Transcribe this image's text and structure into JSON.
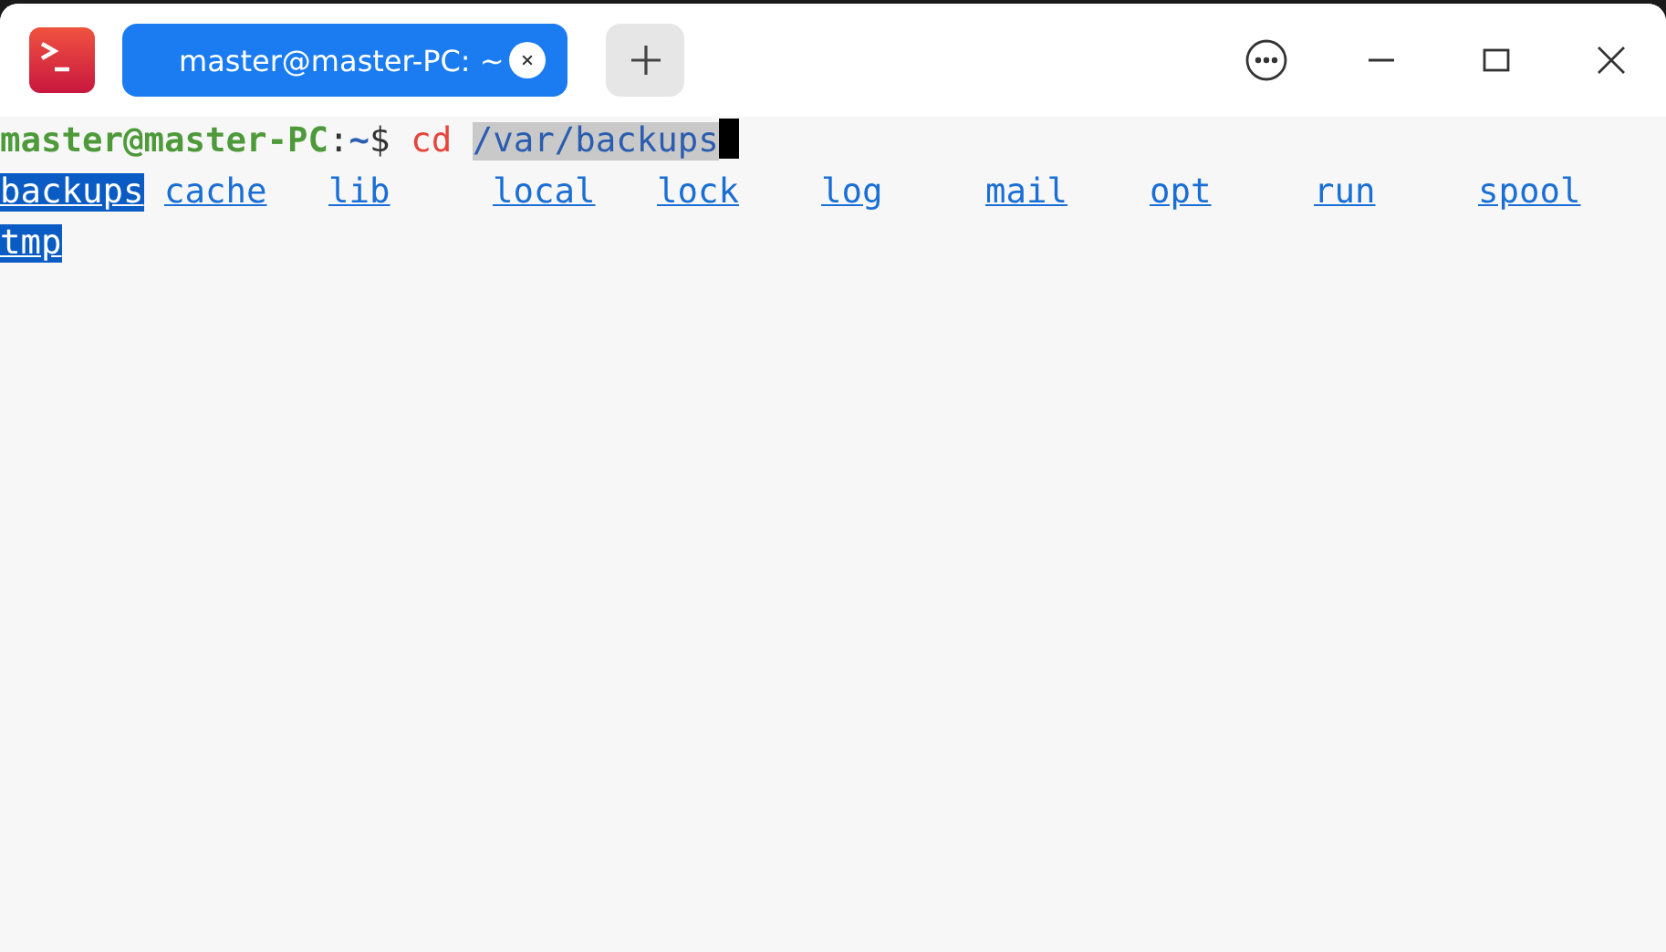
{
  "tabs": [
    {
      "label": "master@master-PC: ~",
      "selected": true
    }
  ],
  "terminal": {
    "prompt": {
      "user_host": "master@master-PC",
      "separator": ":",
      "path": "~",
      "symbol": "$"
    },
    "command": "cd",
    "argument": "/var/backups",
    "argument_selected": true,
    "cursor": true,
    "entries": [
      {
        "name": "backups",
        "selected": true
      },
      {
        "name": "cache",
        "selected": false
      },
      {
        "name": "lib",
        "selected": false
      },
      {
        "name": "local",
        "selected": false
      },
      {
        "name": "lock",
        "selected": false
      },
      {
        "name": "log",
        "selected": false
      },
      {
        "name": "mail",
        "selected": false
      },
      {
        "name": "opt",
        "selected": false
      },
      {
        "name": "run",
        "selected": false
      },
      {
        "name": "spool",
        "selected": false
      },
      {
        "name": "tmp",
        "selected": true
      }
    ]
  }
}
